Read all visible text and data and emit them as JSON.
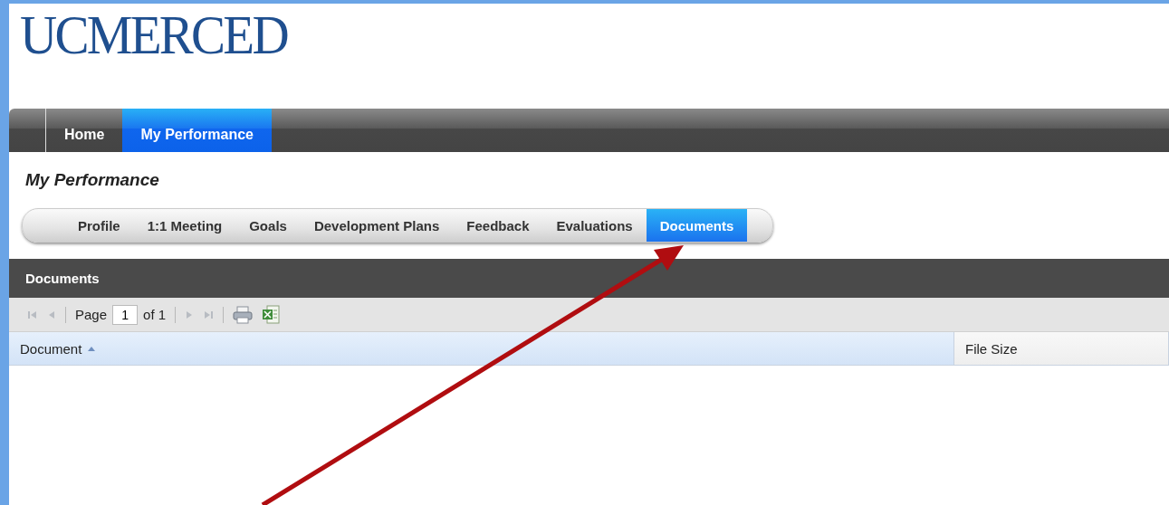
{
  "logo": {
    "text": "UCMERCED"
  },
  "nav_tabs": [
    {
      "label": "Home",
      "selected": false
    },
    {
      "label": "My Performance",
      "selected": true
    }
  ],
  "page_title": "My Performance",
  "sub_tabs": [
    {
      "label": "Profile",
      "selected": false
    },
    {
      "label": "1:1 Meeting",
      "selected": false
    },
    {
      "label": "Goals",
      "selected": false
    },
    {
      "label": "Development Plans",
      "selected": false
    },
    {
      "label": "Feedback",
      "selected": false
    },
    {
      "label": "Evaluations",
      "selected": false
    },
    {
      "label": "Documents",
      "selected": true
    }
  ],
  "panel": {
    "title": "Documents",
    "pager": {
      "page_label": "Page",
      "page_value": "1",
      "of_label": "of 1"
    },
    "columns": [
      {
        "label": "Document",
        "sorted": true
      },
      {
        "label": "File Size",
        "sorted": false
      }
    ]
  }
}
